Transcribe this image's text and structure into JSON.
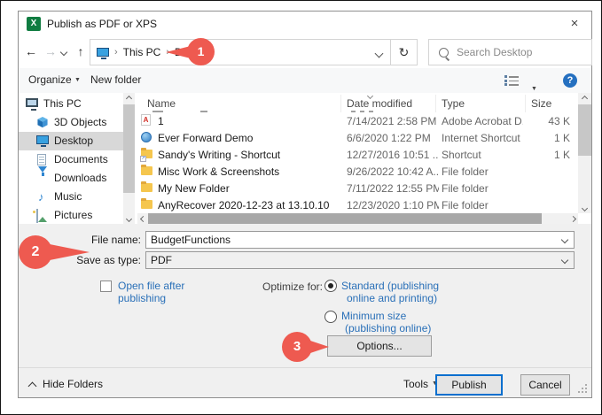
{
  "window": {
    "title": "Publish as PDF or XPS"
  },
  "icons": {
    "back": "←",
    "forward": "→",
    "up": "↑",
    "refresh": "↻",
    "close": "×",
    "caret_down": "▼",
    "help": "?",
    "music": "♪",
    "shortcut_arrow": "↗",
    "pdf_letter": "A",
    "excel_x": "X"
  },
  "colors": {
    "annotation": "#ee5a50",
    "link_blue": "#2a70b8",
    "excel_green": "#107c41",
    "publish_border": "#0b6fce"
  },
  "nav": {
    "breadcrumb": {
      "separator": "›",
      "items": [
        "This PC",
        "Desktop"
      ]
    },
    "search_placeholder": "Search Desktop"
  },
  "toolbar": {
    "organize": "Organize",
    "new_folder": "New folder"
  },
  "sidebar": {
    "items": [
      {
        "label": "This PC"
      },
      {
        "label": "3D Objects"
      },
      {
        "label": "Desktop"
      },
      {
        "label": "Documents"
      },
      {
        "label": "Downloads"
      },
      {
        "label": "Music"
      },
      {
        "label": "Pictures"
      }
    ]
  },
  "file_list": {
    "columns": [
      "Name",
      "Date modified",
      "Type",
      "Size"
    ],
    "rows": [
      {
        "name": "1",
        "date": "7/14/2021 2:58 PM",
        "type": "Adobe Acrobat D...",
        "size": "43 K"
      },
      {
        "name": "Ever Forward Demo",
        "date": "6/6/2020 1:22 PM",
        "type": "Internet Shortcut",
        "size": "1 K"
      },
      {
        "name": "Sandy's Writing - Shortcut",
        "date": "12/27/2016 10:51 ...",
        "type": "Shortcut",
        "size": "1 K"
      },
      {
        "name": "Misc Work & Screenshots",
        "date": "9/26/2022 10:42 A...",
        "type": "File folder",
        "size": ""
      },
      {
        "name": "My New Folder",
        "date": "7/11/2022 12:55 PM",
        "type": "File folder",
        "size": ""
      },
      {
        "name": "AnyRecover 2020-12-23 at 13.10.10",
        "date": "12/23/2020 1:10 PM",
        "type": "File folder",
        "size": ""
      }
    ]
  },
  "form": {
    "file_name_label": "File name:",
    "file_name_value": "BudgetFunctions",
    "save_type_label": "Save as type:",
    "save_type_value": "PDF",
    "open_after_line1": "Open file after",
    "open_after_line2": "publishing",
    "optimize_label": "Optimize for:",
    "radio1_line1": "Standard (publishing",
    "radio1_line2": "online and printing)",
    "radio2_line1": "Minimum size",
    "radio2_line2": "(publishing online)",
    "options_button": "Options..."
  },
  "footer": {
    "hide_folders": "Hide Folders",
    "tools": "Tools",
    "publish": "Publish",
    "cancel": "Cancel"
  },
  "annotations": {
    "step1": "1",
    "step2": "2",
    "step3": "3"
  }
}
